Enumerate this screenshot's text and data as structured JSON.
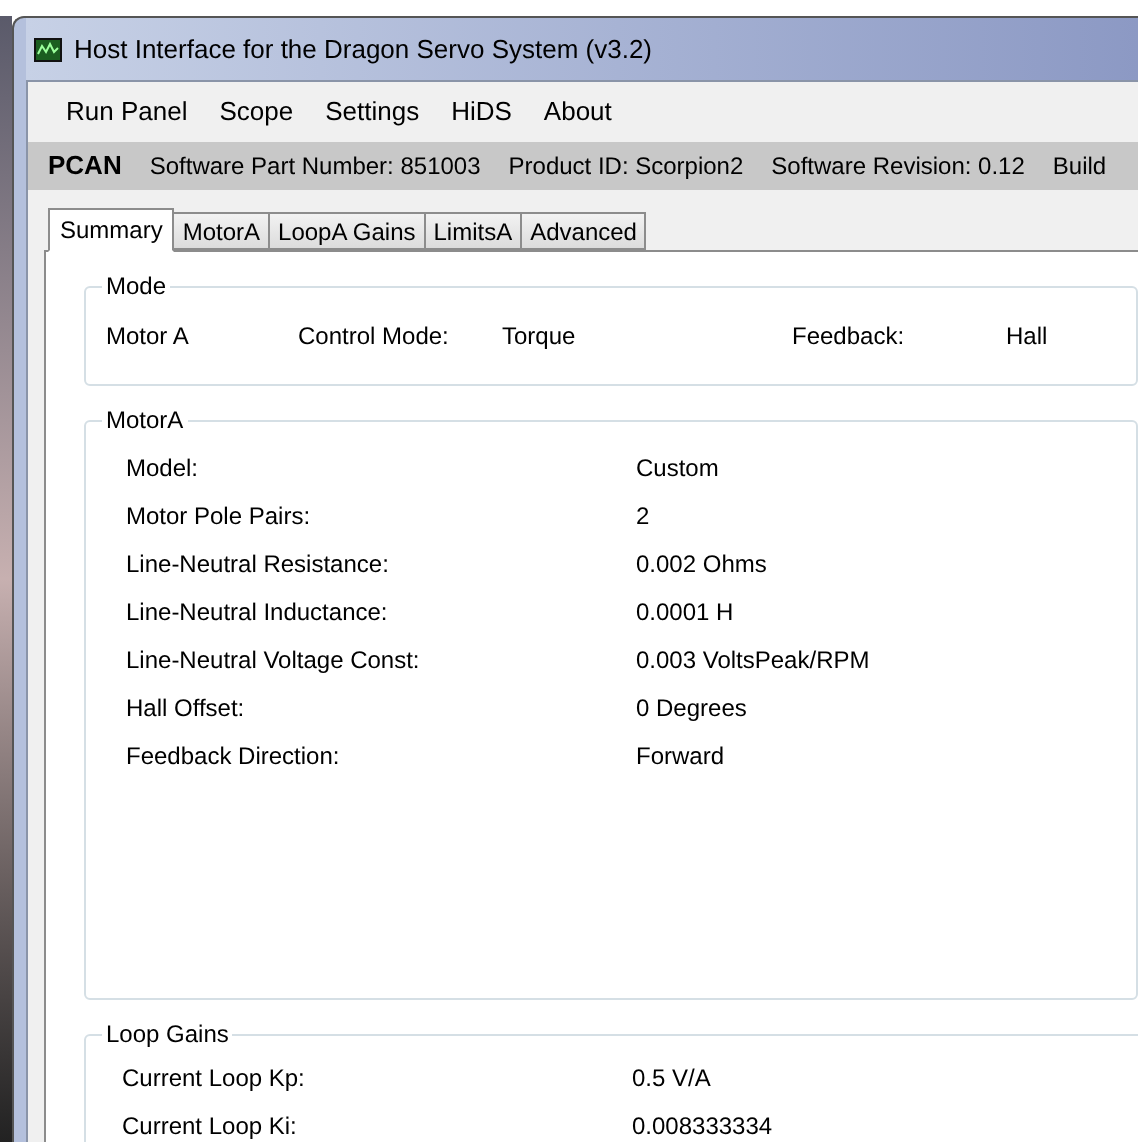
{
  "window": {
    "title": "Host Interface for the Dragon Servo System (v3.2)"
  },
  "menu": [
    "Run Panel",
    "Scope",
    "Settings",
    "HiDS",
    "About"
  ],
  "info_bar": {
    "interface": "PCAN",
    "items": [
      "Software Part Number: 851003",
      "Product ID: Scorpion2",
      "Software Revision: 0.12",
      "Build"
    ]
  },
  "tabs": [
    {
      "label": "Summary",
      "selected": true
    },
    {
      "label": "MotorA",
      "selected": false
    },
    {
      "label": "LoopA Gains",
      "selected": false
    },
    {
      "label": "LimitsA",
      "selected": false
    },
    {
      "label": "Advanced",
      "selected": false
    }
  ],
  "mode": {
    "title": "Mode",
    "motor": "Motor A",
    "control_mode_label": "Control Mode:",
    "control_mode": "Torque",
    "feedback_label": "Feedback:",
    "feedback": "Hall"
  },
  "motor": {
    "title": "MotorA",
    "rows": [
      {
        "label": "Model:",
        "value": "Custom"
      },
      {
        "label": "Motor Pole Pairs:",
        "value": "2"
      },
      {
        "label": "Line-Neutral Resistance:",
        "value": "0.002 Ohms"
      },
      {
        "label": "Line-Neutral Inductance:",
        "value": "0.0001 H"
      },
      {
        "label": "Line-Neutral Voltage Const:",
        "value": "0.003 VoltsPeak/RPM"
      },
      {
        "label": "Hall Offset:",
        "value": "0 Degrees"
      },
      {
        "label": "Feedback Direction:",
        "value": "Forward"
      }
    ]
  },
  "loop_gains": {
    "title": "Loop Gains",
    "rows": [
      {
        "label": "Current Loop Kp:",
        "value": "0.5 V/A"
      },
      {
        "label": "Current Loop Ki:",
        "value": "0.008333334"
      }
    ]
  }
}
